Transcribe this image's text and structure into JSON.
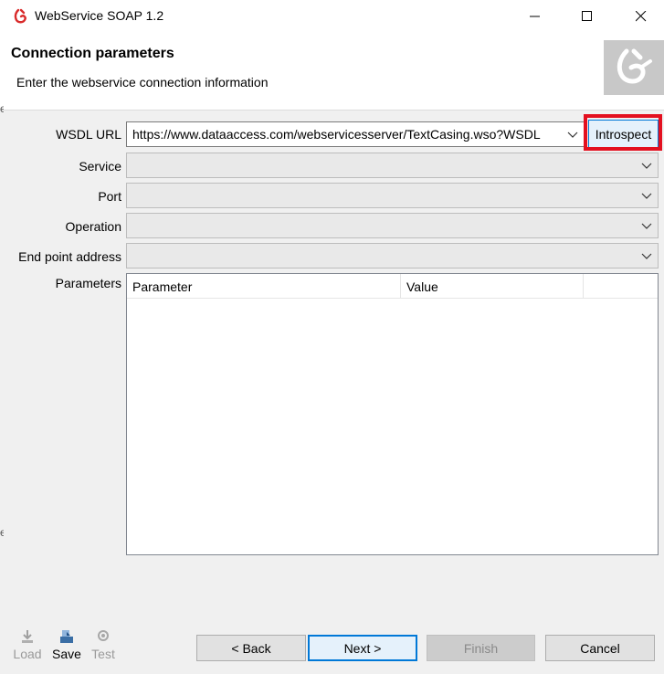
{
  "window": {
    "title": "WebService SOAP 1.2"
  },
  "header": {
    "title": "Connection parameters",
    "subtitle": "Enter the webservice connection information"
  },
  "form": {
    "wsdl_label": "WSDL URL",
    "wsdl_value": "https://www.dataaccess.com/webservicesserver/TextCasing.wso?WSDL",
    "introspect_label": "Introspect",
    "service_label": "Service",
    "port_label": "Port",
    "operation_label": "Operation",
    "endpoint_label": "End point address",
    "parameters_label": "Parameters"
  },
  "table": {
    "columns": [
      "Parameter",
      "Value"
    ]
  },
  "tools": {
    "load": "Load",
    "save": "Save",
    "test": "Test"
  },
  "nav": {
    "back": "< Back",
    "next": "Next >",
    "finish": "Finish",
    "cancel": "Cancel"
  },
  "colors": {
    "accent": "#0078d7",
    "highlight": "#e3101f",
    "logo": "#d92b2b"
  }
}
